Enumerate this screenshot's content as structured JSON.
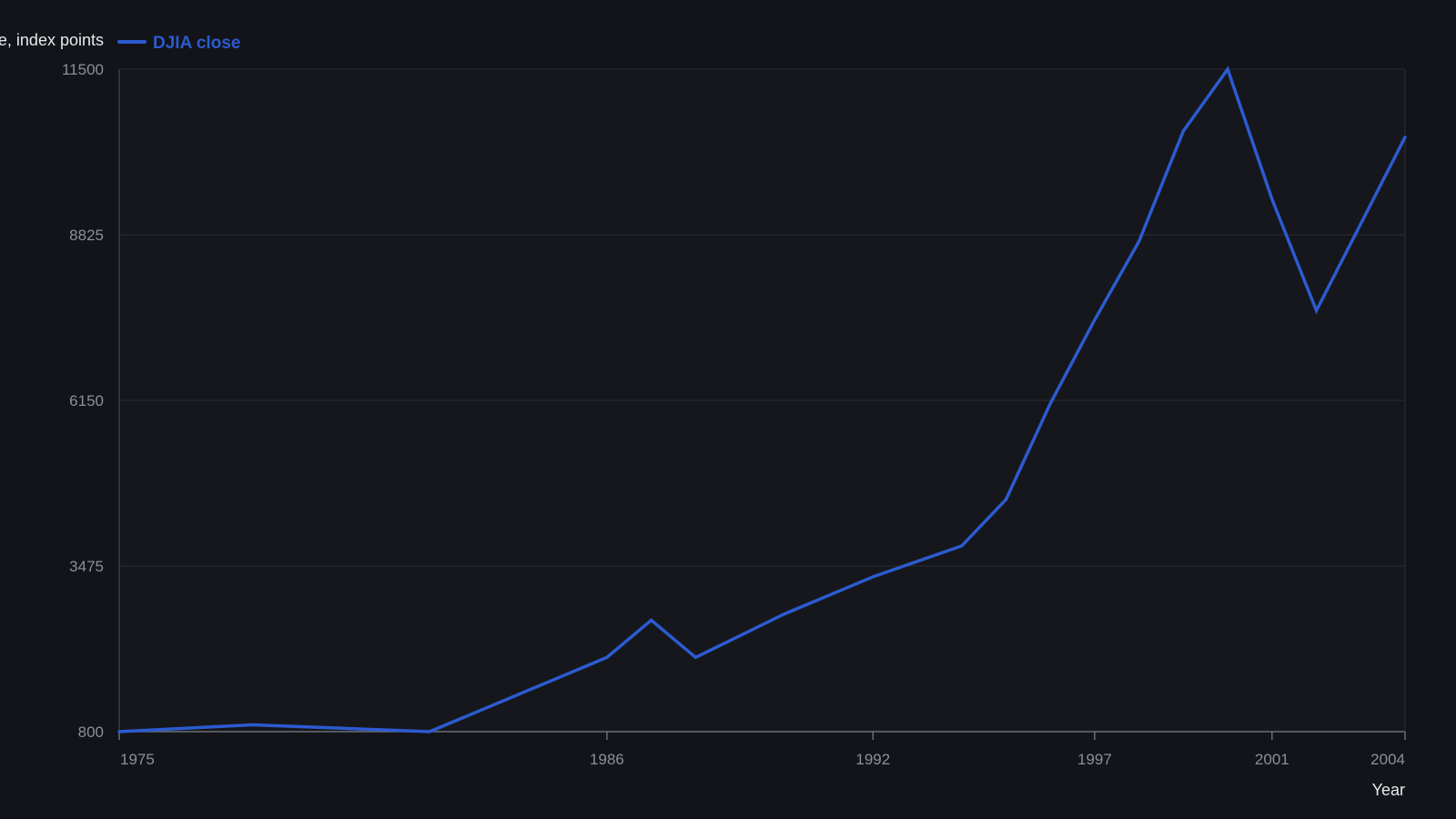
{
  "chart_data": {
    "type": "line",
    "title": "",
    "xlabel": "Year",
    "ylabel": "Value, index points",
    "ylim": [
      800,
      11500
    ],
    "xlim": [
      1975,
      2004
    ],
    "x_ticks": [
      1975,
      1986,
      1992,
      1997,
      2001,
      2004
    ],
    "y_ticks": [
      800,
      3475,
      6150,
      8825,
      11500
    ],
    "grid": true,
    "legend_position": "top-left",
    "series": [
      {
        "name": "DJIA close",
        "color": "#2c5bd0",
        "x": [
          1975,
          1978,
          1982,
          1986,
          1987,
          1988,
          1990,
          1992,
          1994,
          1995,
          1996,
          1997,
          1998,
          1999,
          2000,
          2001,
          2002,
          2004
        ],
        "y": [
          800,
          910,
          800,
          2000,
          2600,
          2000,
          2700,
          3300,
          3800,
          4550,
          6100,
          7450,
          8720,
          10500,
          11500,
          9400,
          7600,
          10400
        ]
      }
    ]
  }
}
